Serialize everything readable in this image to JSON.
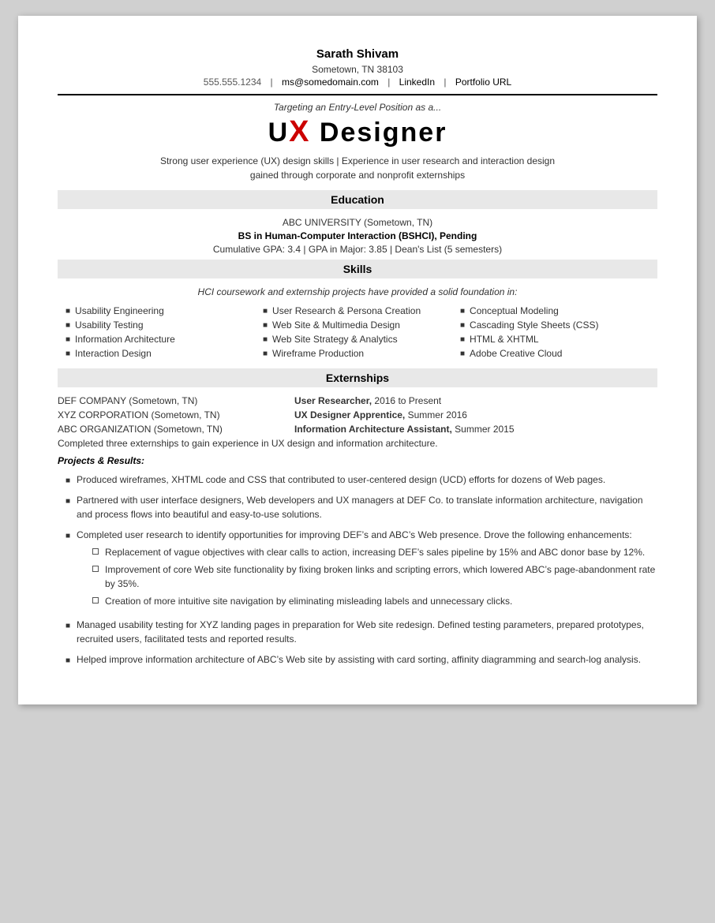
{
  "header": {
    "name": "Sarath Shivam",
    "address": "Sometown, TN 38103",
    "phone": "555.555.1234",
    "email": "ms@somedomain.com",
    "linkedin": "LinkedIn",
    "portfolio": "Portfolio URL",
    "targeting_line": "Targeting an Entry-Level Position as a...",
    "title_prefix": "U",
    "title_x": "X",
    "title_suffix": " Designer",
    "tagline_line1": "Strong user experience (UX) design skills  |  Experience in user research and interaction design",
    "tagline_line2": "gained through corporate and nonprofit externships"
  },
  "education": {
    "section_label": "Education",
    "university": "ABC UNIVERSITY (Sometown, TN)",
    "degree": "BS in Human-Computer Interaction (BSHCI), Pending",
    "gpa": "Cumulative GPA: 3.4  |  GPA in Major: 3.85  |  Dean's List (5 semesters)"
  },
  "skills": {
    "section_label": "Skills",
    "intro": "HCI coursework and externship projects have provided a solid foundation in:",
    "col1": [
      "Usability Engineering",
      "Usability Testing",
      "Information Architecture",
      "Interaction Design"
    ],
    "col2": [
      "User Research & Persona Creation",
      "Web Site & Multimedia Design",
      "Web Site Strategy & Analytics",
      "Wireframe Production"
    ],
    "col3": [
      "Conceptual Modeling",
      "Cascading Style Sheets (CSS)",
      "HTML & XHTML",
      "Adobe Creative Cloud"
    ]
  },
  "externships": {
    "section_label": "Externships",
    "items": [
      {
        "company": "DEF COMPANY (Sometown, TN)",
        "role_bold": "User Researcher,",
        "role_text": " 2016 to Present"
      },
      {
        "company": "XYZ CORPORATION (Sometown, TN)",
        "role_bold": "UX Designer Apprentice,",
        "role_text": " Summer 2016"
      },
      {
        "company": "ABC ORGANIZATION (Sometown, TN)",
        "role_bold": "Information Architecture Assistant,",
        "role_text": " Summer 2015"
      }
    ],
    "summary": "Completed three externships to gain experience in UX design and information architecture.",
    "projects_header": "Projects & Results:",
    "bullets": [
      {
        "text": "Produced wireframes, XHTML code and CSS that contributed to user-centered design (UCD) efforts for dozens of Web pages.",
        "sub": []
      },
      {
        "text": "Partnered with user interface designers, Web developers and UX managers at DEF Co. to translate information architecture, navigation and process flows into beautiful and easy-to-use solutions.",
        "sub": []
      },
      {
        "text": "Completed user research to identify opportunities for improving DEF’s and ABC’s Web presence. Drove the following enhancements:",
        "sub": [
          "Replacement of vague objectives with clear calls to action, increasing DEF’s sales pipeline by 15% and ABC donor base by 12%.",
          "Improvement of core Web site functionality by fixing broken links and scripting errors, which lowered ABC’s page-abandonment rate by 35%.",
          "Creation of more intuitive site navigation by eliminating misleading labels and unnecessary clicks."
        ]
      },
      {
        "text": "Managed usability testing for XYZ landing pages in preparation for Web site redesign. Defined testing parameters, prepared prototypes, recruited users, facilitated tests and reported results.",
        "sub": []
      },
      {
        "text": "Helped improve information architecture of ABC’s Web site by assisting with card sorting, affinity diagramming and search-log analysis.",
        "sub": []
      }
    ]
  }
}
